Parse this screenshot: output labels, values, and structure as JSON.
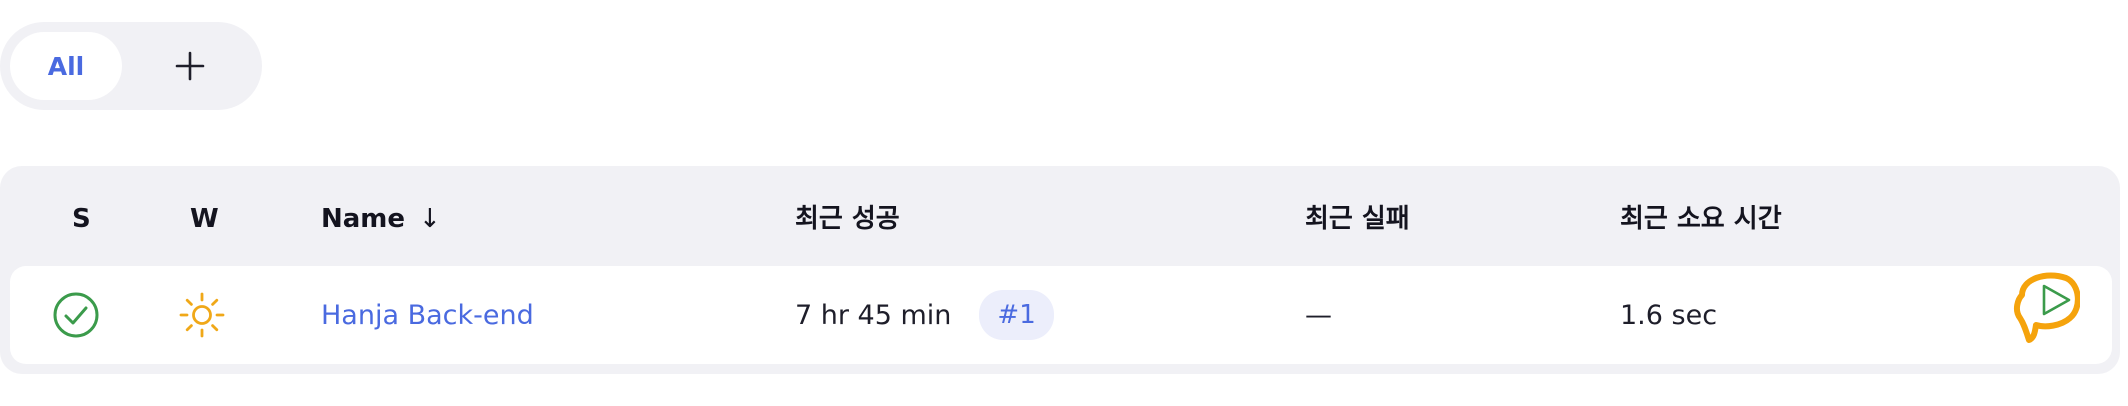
{
  "tabs": {
    "all_label": "All",
    "add_label": "+"
  },
  "table": {
    "headers": {
      "status": "S",
      "weather": "W",
      "name": "Name",
      "name_sort_indicator": "↓",
      "last_success": "최근 성공",
      "last_failure": "최근 실패",
      "last_duration": "최근 소요 시간"
    },
    "rows": [
      {
        "status_icon": "check-circle-icon",
        "weather_icon": "sun-icon",
        "name": "Hanja Back-end",
        "last_success": "7 hr 45 min",
        "last_success_build": "#1",
        "last_failure": "—",
        "last_duration": "1.6 sec",
        "action_icon": "play-icon"
      }
    ]
  },
  "colors": {
    "accent": "#4a6ae0",
    "success": "#3b9b4b",
    "weather_sunny": "#f0a818",
    "annotation_highlight": "#f5a30c",
    "surface": "#f1f1f5"
  }
}
